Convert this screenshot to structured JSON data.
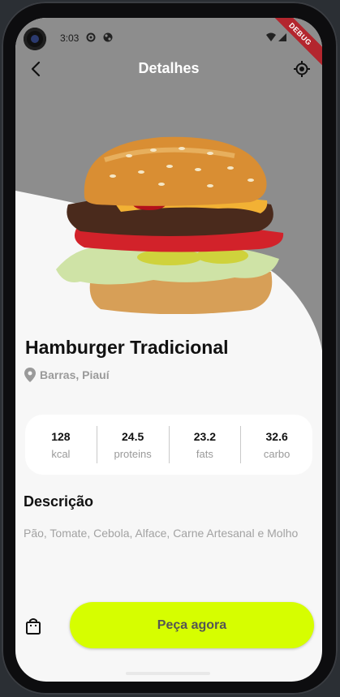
{
  "status_bar": {
    "time": "3:03",
    "debug_label": "DEBUG"
  },
  "app_bar": {
    "title": "Detalhes"
  },
  "product": {
    "name": "Hamburger Tradicional",
    "location": "Barras, Piauí"
  },
  "stats": [
    {
      "value": "128",
      "label": "kcal"
    },
    {
      "value": "24.5",
      "label": "proteins"
    },
    {
      "value": "23.2",
      "label": "fats"
    },
    {
      "value": "32.6",
      "label": "carbo"
    }
  ],
  "description": {
    "title": "Descrição",
    "text": "Pão, Tomate, Cebola, Alface, Carne Artesanal e Molho"
  },
  "actions": {
    "order_label": "Peça agora"
  },
  "colors": {
    "accent": "#d6fe00",
    "hero_bg": "#8d8d8d",
    "debug": "#b3262e"
  }
}
